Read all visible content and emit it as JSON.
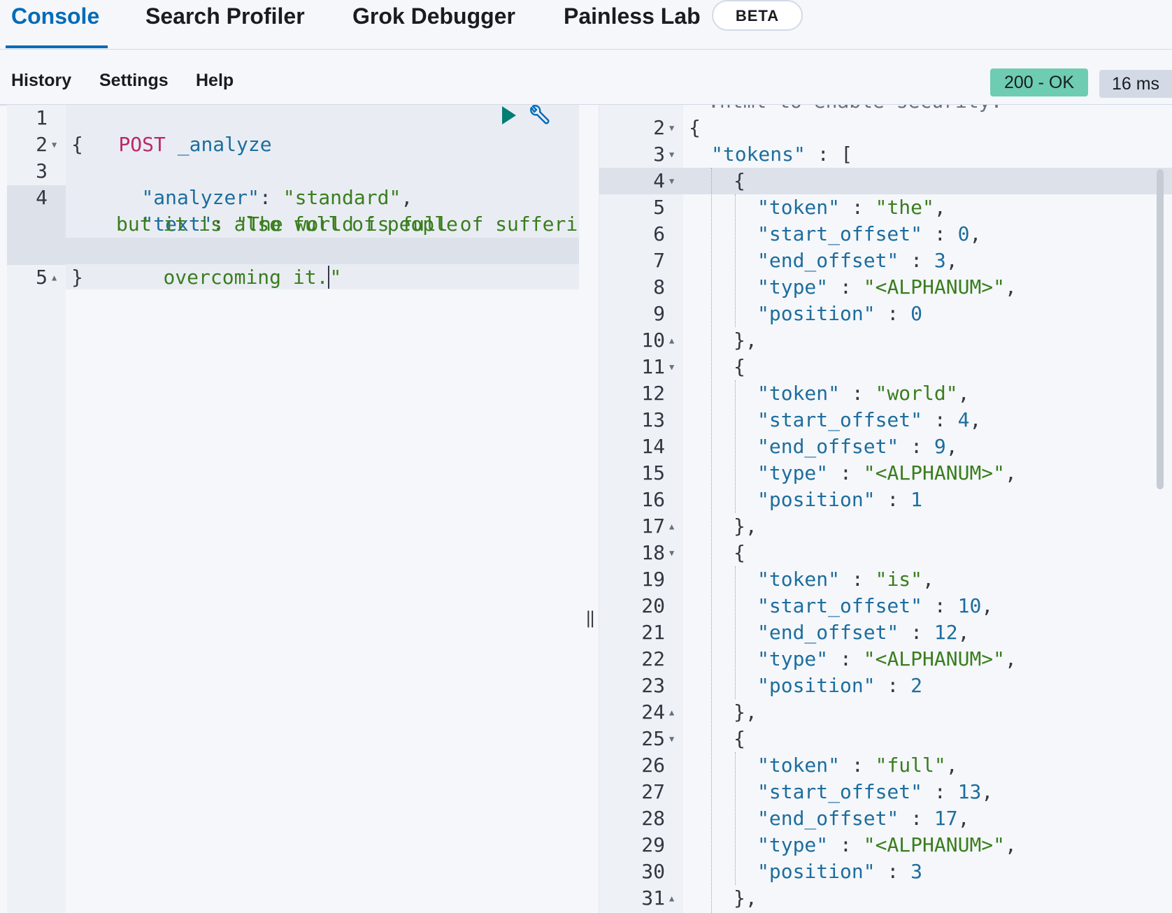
{
  "tabs": [
    {
      "label": "Console"
    },
    {
      "label": "Search Profiler"
    },
    {
      "label": "Grok Debugger"
    },
    {
      "label": "Painless Lab"
    }
  ],
  "beta_badge": "BETA",
  "toolbar": {
    "history": "History",
    "settings": "Settings",
    "help": "Help"
  },
  "response_status": {
    "status": "200 - OK",
    "timing": "16 ms"
  },
  "request": {
    "method": "POST",
    "endpoint": "_analyze",
    "analyzer_key": "\"analyzer\"",
    "analyzer_value": "\"standard\"",
    "text_key": "\"text\"",
    "text_value_1": "\"The world is full of suffering",
    "text_value_2": "but it is also full of people",
    "text_value_3": "overcoming it.",
    "text_value_end": "\""
  },
  "response": {
    "first_line_partial": ".html to enable security.",
    "tokens_key": "\"tokens\"",
    "tokens": [
      {
        "token": "\"the\"",
        "start_offset": "0",
        "end_offset": "3",
        "type": "\"<ALPHANUM>\"",
        "position": "0"
      },
      {
        "token": "\"world\"",
        "start_offset": "4",
        "end_offset": "9",
        "type": "\"<ALPHANUM>\"",
        "position": "1"
      },
      {
        "token": "\"is\"",
        "start_offset": "10",
        "end_offset": "12",
        "type": "\"<ALPHANUM>\"",
        "position": "2"
      },
      {
        "token": "\"full\"",
        "start_offset": "13",
        "end_offset": "17",
        "type": "\"<ALPHANUM>\"",
        "position": "3"
      }
    ]
  },
  "colors": {
    "accent": "#006bb8",
    "status_ok": "#6dccb1",
    "method": "#bd2768",
    "string": "#3a7d1e",
    "key": "#1d6d9e"
  }
}
